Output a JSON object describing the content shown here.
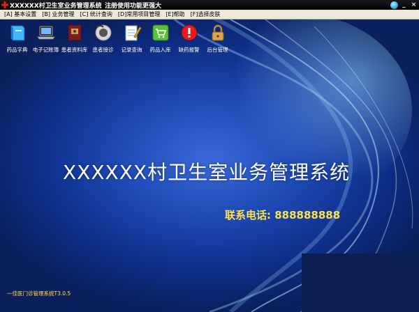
{
  "titlebar": {
    "title": "XXXXXX村卫生室业务管理系统",
    "notice": "注册使用功能更强大",
    "minimize": "_",
    "close": "×"
  },
  "menu": [
    "[A] 基本设置",
    "[B] 业务管理",
    "[C] 统计查询",
    "[D]常用项目管理",
    "[E]帮助",
    "[F]选择皮肤"
  ],
  "toolbar": [
    {
      "label": "药品字典",
      "icon": "book-icon"
    },
    {
      "label": "电子记账簿",
      "icon": "laptop-icon"
    },
    {
      "label": "患者资料库",
      "icon": "folder-icon"
    },
    {
      "label": "患者接诊",
      "icon": "stethoscope-icon"
    },
    {
      "label": "记录查询",
      "icon": "notepad-icon"
    },
    {
      "label": "药品入库",
      "icon": "cart-icon"
    },
    {
      "label": "缺药报警",
      "icon": "alert-icon"
    },
    {
      "label": "后台管理",
      "icon": "lock-icon"
    }
  ],
  "main": {
    "title": "XXXXXX村卫生室业务管理系统",
    "phone": "联系电话: 888888888",
    "version": "一佳医门诊管理系统T3.0.5"
  },
  "colors": {
    "accent_yellow": "#ffe14a",
    "bg_dark": "#0a1f5c",
    "bg_light": "#3a6ad8"
  }
}
